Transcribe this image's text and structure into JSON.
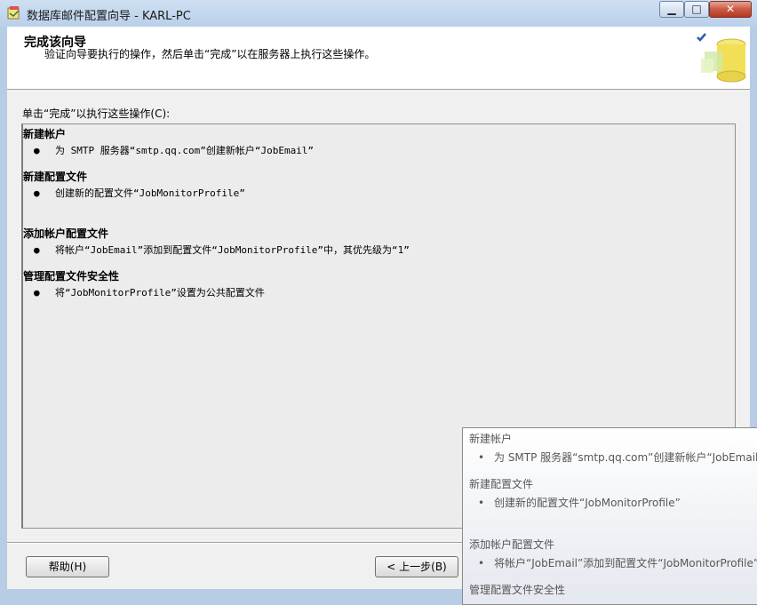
{
  "window": {
    "title": "数据库邮件配置向导 - KARL-PC",
    "min_glyph": "▁",
    "max_glyph": "□",
    "close_glyph": "✕"
  },
  "header": {
    "title": "完成该向导",
    "subtitle": "验证向导要执行的操作，然后单击“完成”以在服务器上执行这些操作。"
  },
  "instruction": "单击“完成”以执行这些操作(C):",
  "summary": [
    {
      "heading": "新建帐户",
      "items": [
        "为 SMTP 服务器“smtp.qq.com”创建新帐户“JobEmail”"
      ]
    },
    {
      "heading": "新建配置文件",
      "items": [
        "创建新的配置文件“JobMonitorProfile”"
      ]
    },
    {
      "heading": "添加帐户配置文件",
      "items": [
        "将帐户“JobEmail”添加到配置文件“JobMonitorProfile”中，其优先级为“1”"
      ]
    },
    {
      "heading": "管理配置文件安全性",
      "items": [
        "将“JobMonitorProfile”设置为公共配置文件"
      ]
    }
  ],
  "bullet": "●",
  "tooltip": [
    {
      "heading": "新建帐户",
      "items": [
        "为 SMTP 服务器“smtp.qq.com”创建新帐户“JobEmail”"
      ]
    },
    {
      "heading": "新建配置文件",
      "items": [
        "创建新的配置文件“JobMonitorProfile”"
      ]
    },
    {
      "heading": "添加帐户配置文件",
      "items": [
        "将帐户“JobEmail”添加到配置文件“JobMonitorProfile”中"
      ]
    },
    {
      "heading": "管理配置文件安全性",
      "items": []
    }
  ],
  "tip_bullet": "•",
  "buttons": {
    "help": "帮助(H)",
    "back": "< 上一步(B)"
  }
}
